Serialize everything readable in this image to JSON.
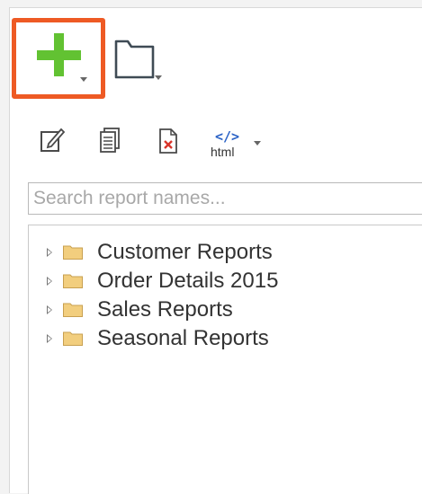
{
  "toolbar": {
    "add_icon": "plus-icon",
    "folder_icon": "folder-icon",
    "actions": [
      {
        "name": "edit-icon"
      },
      {
        "name": "copy-icon"
      },
      {
        "name": "delete-icon"
      },
      {
        "name": "html-export-icon",
        "label": "html",
        "code": "</>"
      }
    ]
  },
  "search": {
    "placeholder": "Search report names..."
  },
  "tree": {
    "items": [
      {
        "label": "Customer Reports"
      },
      {
        "label": "Order Details 2015"
      },
      {
        "label": "Sales Reports"
      },
      {
        "label": "Seasonal Reports"
      }
    ]
  },
  "colors": {
    "accent_border": "#ee5a24",
    "plus_green": "#62c232",
    "folder_fill": "#f2ce7e",
    "delete_red": "#d9352b",
    "html_blue": "#2b63c6"
  }
}
